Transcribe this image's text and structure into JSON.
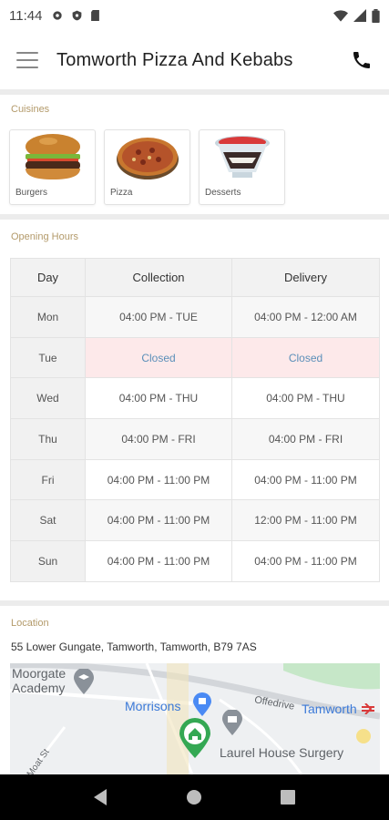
{
  "status_bar": {
    "time": "11:44"
  },
  "app_bar": {
    "title": "Tomworth Pizza And Kebabs"
  },
  "cuisines": {
    "label": "Cuisines",
    "items": [
      {
        "name": "Burgers"
      },
      {
        "name": "Pizza"
      },
      {
        "name": "Desserts"
      }
    ]
  },
  "opening_hours": {
    "label": "Opening Hours",
    "headers": {
      "day": "Day",
      "collection": "Collection",
      "delivery": "Delivery"
    },
    "rows": [
      {
        "day": "Mon",
        "collection": "04:00 PM - TUE",
        "delivery": "04:00 PM - 12:00 AM"
      },
      {
        "day": "Tue",
        "collection": "Closed",
        "delivery": "Closed"
      },
      {
        "day": "Wed",
        "collection": "04:00 PM - THU",
        "delivery": "04:00 PM - THU"
      },
      {
        "day": "Thu",
        "collection": "04:00 PM - FRI",
        "delivery": "04:00 PM - FRI"
      },
      {
        "day": "Fri",
        "collection": "04:00 PM - 11:00 PM",
        "delivery": "04:00 PM - 11:00 PM"
      },
      {
        "day": "Sat",
        "collection": "04:00 PM - 11:00 PM",
        "delivery": "12:00 PM - 11:00 PM"
      },
      {
        "day": "Sun",
        "collection": "04:00 PM - 11:00 PM",
        "delivery": "04:00 PM - 11:00 PM"
      }
    ]
  },
  "location": {
    "label": "Location",
    "address": "55 Lower Gungate, Tamworth, Tamworth, B79 7AS",
    "map_labels": {
      "academy_line1": "Moorgate",
      "academy_line2": "Academy",
      "morrisons": "Morrisons",
      "offedrive": "Offedrive",
      "tamworth": "Tamworth",
      "surgery": "Laurel House Surgery",
      "street": "Moat St"
    }
  },
  "colors": {
    "accent_label": "#b39a6a",
    "closed_bg": "#fde9ea",
    "closed_text": "#5b8fb9"
  }
}
